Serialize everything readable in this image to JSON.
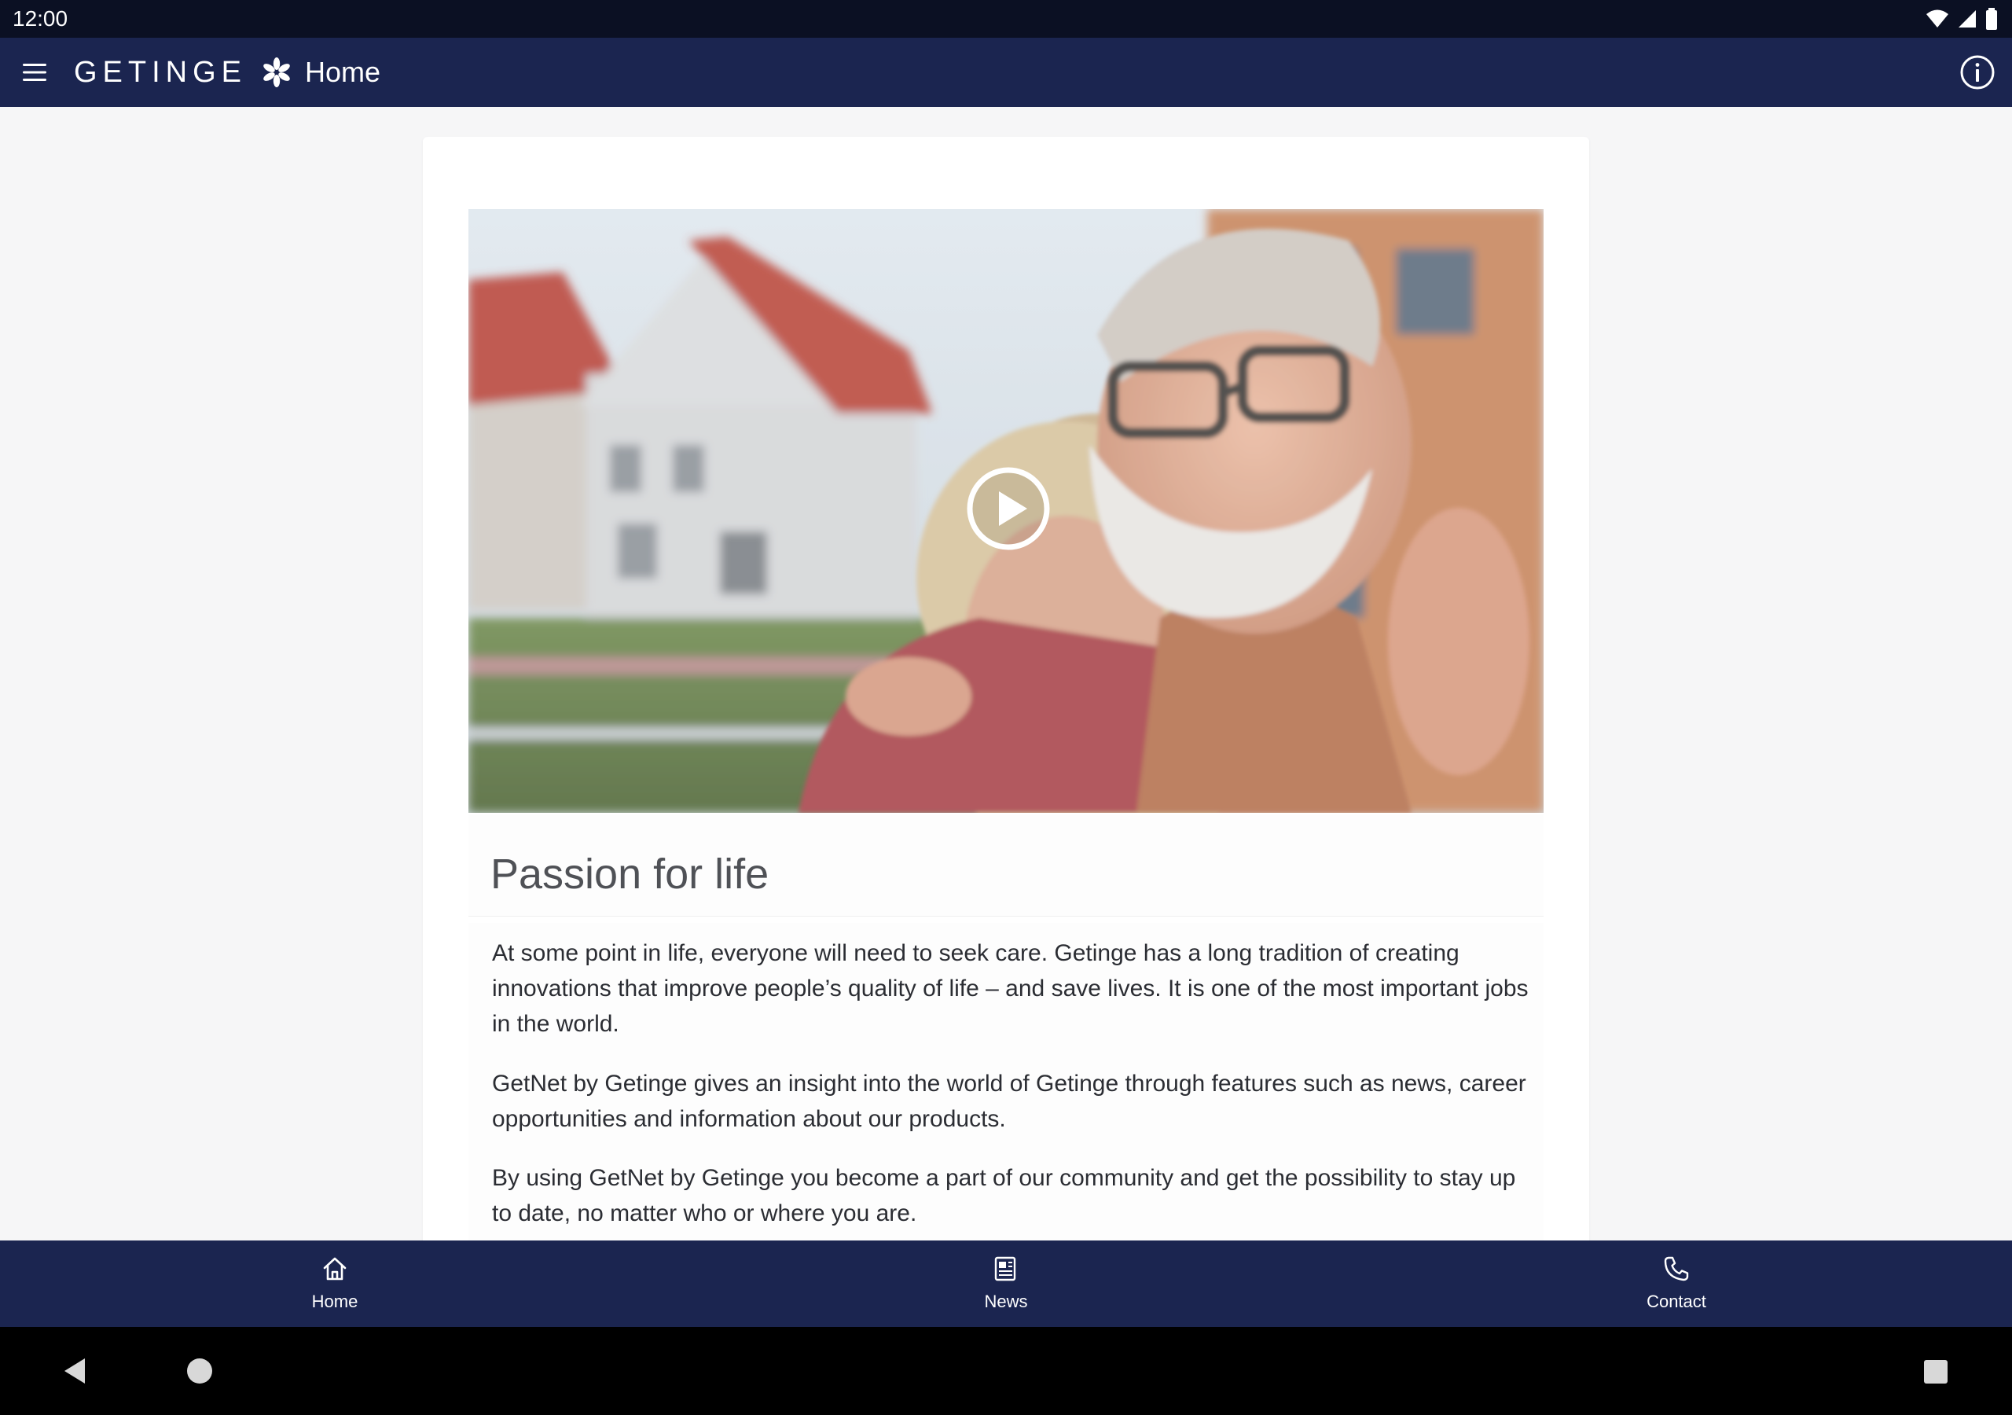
{
  "status_bar": {
    "time": "12:00",
    "icons": [
      "wifi-icon",
      "cell-signal-icon",
      "battery-icon"
    ]
  },
  "app_bar": {
    "menu_icon": "hamburger-menu-icon",
    "brand_name": "GETINGE",
    "brand_icon": "getinge-star-logo",
    "title": "Home",
    "info_icon": "info-icon"
  },
  "article": {
    "video": {
      "description": "video-thumbnail",
      "play_icon": "play-circle-icon"
    },
    "headline": "Passion for life",
    "paragraphs": [
      "At some point in life, everyone will need to seek care. Getinge has a long tradition of creating innovations that improve people’s quality of life – and save lives. It is one of the most important jobs in the world.",
      "GetNet by Getinge gives an insight into the world of Getinge through features such as news, career opportunities and information about our products.",
      "By using GetNet by Getinge you become a part of our community and get the possibility to stay up to date, no matter who or where you are."
    ]
  },
  "bottom_nav": {
    "items": [
      {
        "label": "Home",
        "icon": "home-icon"
      },
      {
        "label": "News",
        "icon": "news-icon"
      },
      {
        "label": "Contact",
        "icon": "phone-icon"
      }
    ]
  },
  "system_nav": {
    "back_icon": "back-triangle-icon",
    "home_icon": "home-circle-icon",
    "recents_icon": "recents-square-icon"
  },
  "colors": {
    "status_bar": "#0b1023",
    "app_bar": "#1b2550",
    "page_background": "#f6f6f7",
    "card": "#ffffff",
    "headline_text": "#4f5156",
    "body_text": "#2b2d33"
  }
}
